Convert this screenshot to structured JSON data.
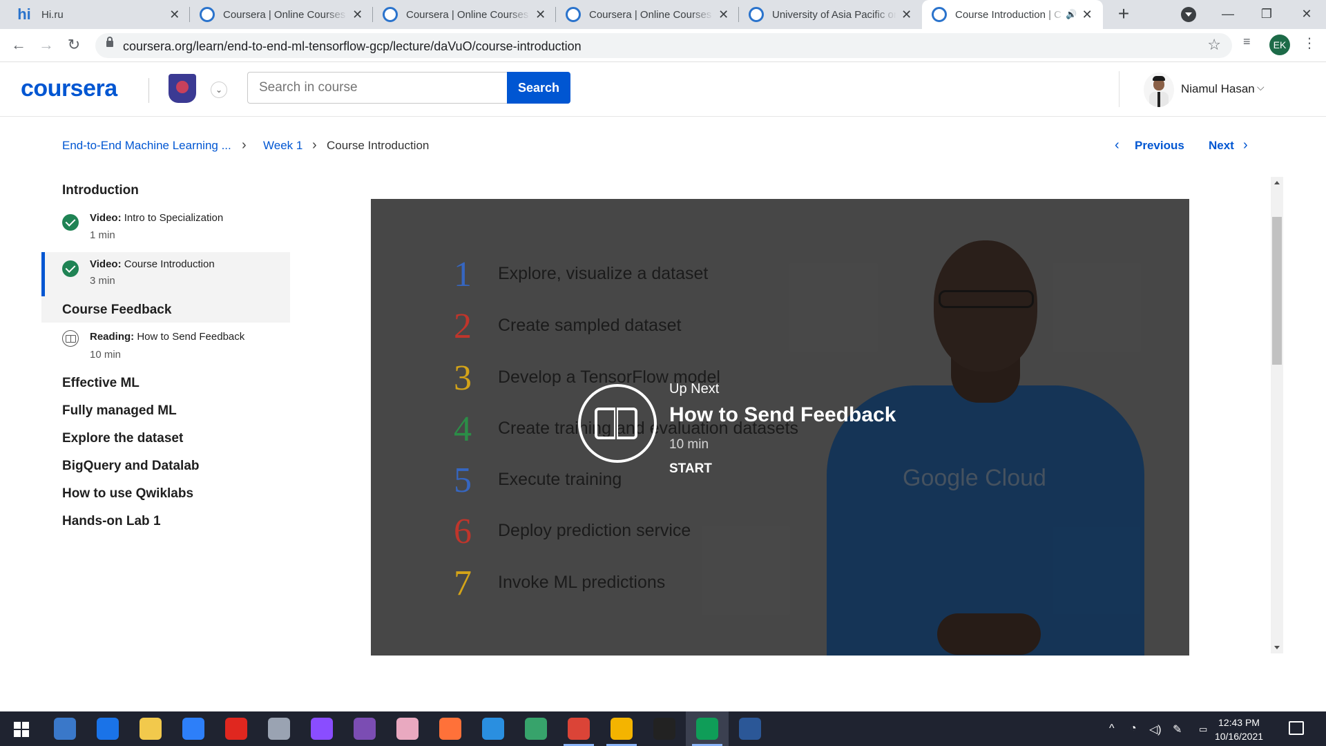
{
  "browser": {
    "tabs": [
      {
        "title": "Hi.ru",
        "favicon": "hi-logo-icon",
        "active": false
      },
      {
        "title": "Coursera | Online Courses & Cr",
        "favicon": "coursera-icon",
        "active": false
      },
      {
        "title": "Coursera | Online Courses & Cr",
        "favicon": "coursera-icon",
        "active": false
      },
      {
        "title": "Coursera | Online Courses & Cr",
        "favicon": "coursera-icon",
        "active": false
      },
      {
        "title": "University of Asia Pacific on Co",
        "favicon": "coursera-icon",
        "active": false
      },
      {
        "title": "Course Introduction | C",
        "favicon": "coursera-icon",
        "active": true,
        "audio": true
      }
    ],
    "new_tab_glyph": "+",
    "url": "coursera.org/learn/end-to-end-ml-tensorflow-gcp/lecture/daVuO/course-introduction",
    "profile_initials": "EK",
    "profile_color": "#1d6b48"
  },
  "header": {
    "logo_text": "coursera",
    "search_placeholder": "Search in course",
    "search_button": "Search",
    "user_name": "Niamul Hasan",
    "brand_color": "#0056d2"
  },
  "breadcrumb": {
    "course": "End-to-End Machine Learning ...",
    "week": "Week 1",
    "current": "Course Introduction"
  },
  "pager": {
    "previous": "Previous",
    "next": "Next"
  },
  "sidebar": {
    "modules": [
      {
        "title": "Introduction"
      },
      {
        "title": "Course Feedback"
      },
      {
        "title": "Effective ML"
      },
      {
        "title": "Fully managed ML"
      },
      {
        "title": "Explore the dataset"
      },
      {
        "title": "BigQuery and Datalab"
      },
      {
        "title": "How to use Qwiklabs"
      },
      {
        "title": "Hands-on Lab 1"
      }
    ],
    "items": [
      {
        "type": "Video:",
        "name": "Intro to Specialization",
        "duration": "1 min",
        "status": "completed",
        "active": false
      },
      {
        "type": "Video:",
        "name": "Course Introduction",
        "duration": "3 min",
        "status": "completed",
        "active": true
      },
      {
        "type": "Reading:",
        "name": "How to Send Feedback",
        "duration": "10 min",
        "status": "not-started",
        "active": false
      }
    ]
  },
  "video": {
    "slide_items": [
      {
        "num": "1",
        "text": "Explore, visualize a dataset",
        "color": "#3b6fd1"
      },
      {
        "num": "2",
        "text": "Create sampled dataset",
        "color": "#d13a2f"
      },
      {
        "num": "3",
        "text": "Develop a TensorFlow model",
        "color": "#e7b21b"
      },
      {
        "num": "4",
        "text": "Create training and evaluation datasets",
        "color": "#2f9a4e"
      },
      {
        "num": "5",
        "text": "Execute training",
        "color": "#3b6fd1"
      },
      {
        "num": "6",
        "text": "Deploy prediction service",
        "color": "#d13a2f"
      },
      {
        "num": "7",
        "text": "Invoke ML predictions",
        "color": "#e7b21b"
      }
    ],
    "shirt_text": "Google Cloud",
    "up_next": {
      "label": "Up Next",
      "title": "How to Send Feedback",
      "duration": "10 min",
      "action": "START"
    }
  },
  "taskbar": {
    "apps": [
      {
        "name": "qbittorrent-icon",
        "color": "#3a78c9"
      },
      {
        "name": "edge-legacy-icon",
        "color": "#1a73e8"
      },
      {
        "name": "file-explorer-icon",
        "color": "#f2c94c"
      },
      {
        "name": "mail-icon",
        "color": "#2d7ff9"
      },
      {
        "name": "opera-icon",
        "color": "#e0271f"
      },
      {
        "name": "satellite-app-icon",
        "color": "#9aa3b2"
      },
      {
        "name": "messenger-icon",
        "color": "#8a4dff"
      },
      {
        "name": "github-desktop-icon",
        "color": "#7b4db3"
      },
      {
        "name": "paint-app-icon",
        "color": "#e9a9c0"
      },
      {
        "name": "firefox-icon",
        "color": "#ff7139"
      },
      {
        "name": "vscode-icon",
        "color": "#2a8fe0"
      },
      {
        "name": "edge-icon",
        "color": "#37a36b"
      },
      {
        "name": "chrome-icon",
        "color": "#db4437"
      },
      {
        "name": "chrome-profile-icon",
        "color": "#f4b400"
      },
      {
        "name": "terminal-icon",
        "color": "#222222"
      },
      {
        "name": "chrome-ek-icon",
        "color": "#0f9d58",
        "active": true
      },
      {
        "name": "word-icon",
        "color": "#2b5797"
      }
    ],
    "time": "12:43 PM",
    "date": "10/16/2021"
  }
}
